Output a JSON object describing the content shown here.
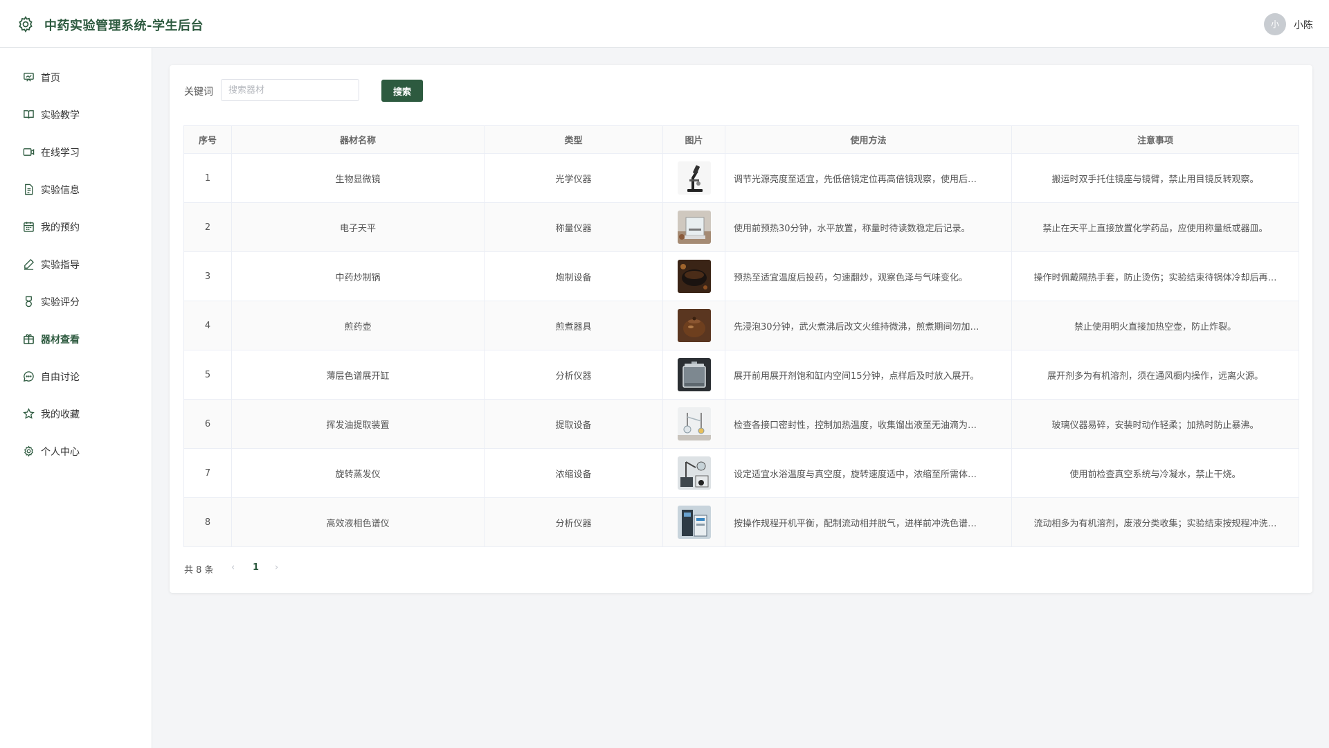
{
  "header": {
    "title": "中药实验管理系统-学生后台",
    "avatar_text": "小",
    "username": "小陈",
    "icon": "gear-icon"
  },
  "sidebar": {
    "items": [
      {
        "label": "首页",
        "icon": "home-board-icon",
        "active": false
      },
      {
        "label": "实验教学",
        "icon": "book-icon",
        "active": false
      },
      {
        "label": "在线学习",
        "icon": "video-camera-icon",
        "active": false
      },
      {
        "label": "实验信息",
        "icon": "document-icon",
        "active": false
      },
      {
        "label": "我的预约",
        "icon": "calendar-icon",
        "active": false
      },
      {
        "label": "实验指导",
        "icon": "pen-icon",
        "active": false
      },
      {
        "label": "实验评分",
        "icon": "medal-icon",
        "active": false
      },
      {
        "label": "器材查看",
        "icon": "package-icon",
        "active": true
      },
      {
        "label": "自由讨论",
        "icon": "chat-icon",
        "active": false
      },
      {
        "label": "我的收藏",
        "icon": "star-icon",
        "active": false
      },
      {
        "label": "个人中心",
        "icon": "gear-icon",
        "active": false
      }
    ]
  },
  "search": {
    "label": "关键词",
    "placeholder": "搜索器材",
    "value": "",
    "button_label": "搜索"
  },
  "table": {
    "columns": [
      "序号",
      "器材名称",
      "类型",
      "图片",
      "使用方法",
      "注意事项"
    ],
    "rows": [
      {
        "no": "1",
        "name": "生物显微镜",
        "type": "光学仪器",
        "image": "microscope",
        "method": "调节光源亮度至适宜，先低倍镜定位再高倍镜观察，使用后…",
        "notes": "搬运时双手托住镜座与镜臂，禁止用目镜反转观察。"
      },
      {
        "no": "2",
        "name": "电子天平",
        "type": "称量仪器",
        "image": "balance",
        "method": "使用前预热30分钟，水平放置，称量时待读数稳定后记录。",
        "notes": "禁止在天平上直接放置化学药品，应使用称量纸或器皿。"
      },
      {
        "no": "3",
        "name": "中药炒制锅",
        "type": "炮制设备",
        "image": "wok",
        "method": "预热至适宜温度后投药，匀速翻炒，观察色泽与气味变化。",
        "notes": "操作时佩戴隔热手套，防止烫伤；实验结束待锅体冷却后再…"
      },
      {
        "no": "4",
        "name": "煎药壶",
        "type": "煎煮器具",
        "image": "pot",
        "method": "先浸泡30分钟，武火煮沸后改文火维持微沸，煎煮期间勿加…",
        "notes": "禁止使用明火直接加热空壶，防止炸裂。"
      },
      {
        "no": "5",
        "name": "薄层色谱展开缸",
        "type": "分析仪器",
        "image": "tank",
        "method": "展开前用展开剂饱和缸内空间15分钟，点样后及时放入展开。",
        "notes": "展开剂多为有机溶剂，须在通风橱内操作，远离火源。"
      },
      {
        "no": "6",
        "name": "挥发油提取装置",
        "type": "提取设备",
        "image": "distiller",
        "method": "检查各接口密封性，控制加热温度，收集馏出液至无油滴为…",
        "notes": "玻璃仪器易碎，安装时动作轻柔；加热时防止暴沸。"
      },
      {
        "no": "7",
        "name": "旋转蒸发仪",
        "type": "浓缩设备",
        "image": "rotavap",
        "method": "设定适宜水浴温度与真空度，旋转速度适中，浓缩至所需体…",
        "notes": "使用前检查真空系统与冷凝水，禁止干烧。"
      },
      {
        "no": "8",
        "name": "高效液相色谱仪",
        "type": "分析仪器",
        "image": "hplc",
        "method": "按操作规程开机平衡，配制流动相并脱气，进样前冲洗色谱…",
        "notes": "流动相多为有机溶剂，废液分类收集；实验结束按规程冲洗…"
      }
    ]
  },
  "pagination": {
    "total_text": "共 8 条",
    "prev": "‹",
    "current_page": "1",
    "next": "›"
  },
  "colors": {
    "brand": "#2d5a3f",
    "background": "#f4f5f7"
  }
}
